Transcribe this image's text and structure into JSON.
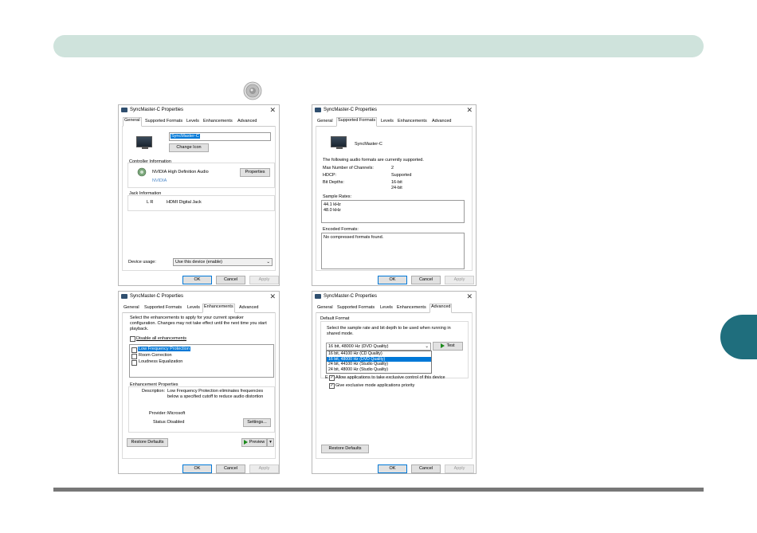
{
  "page": {
    "speaker_icon": "speaker-icon"
  },
  "dialogs": {
    "general": {
      "title": "SyncMaster-C Properties",
      "tabs": [
        "General",
        "Supported Formats",
        "Levels",
        "Enhancements",
        "Advanced"
      ],
      "device_name": "SyncMaster-C",
      "change_icon": "Change Icon",
      "controller_header": "Controller Information",
      "controller_name": "NVIDIA High Definition Audio",
      "controller_vendor": "NVIDIA",
      "properties": "Properties",
      "jack_header": "Jack Information",
      "jack_lr": "L R",
      "jack_name": "HDMI Digital Jack",
      "device_usage_label": "Device usage:",
      "device_usage_value": "Use this device (enable)",
      "ok": "OK",
      "cancel": "Cancel",
      "apply": "Apply"
    },
    "formats": {
      "title": "SyncMaster-C Properties",
      "tabs": [
        "General",
        "Supported Formats",
        "Levels",
        "Enhancements",
        "Advanced"
      ],
      "device_name": "SyncMaster-C",
      "intro": "The following audio formats are currently supported.",
      "max_channels_label": "Max Number of Channels:",
      "max_channels_value": "2",
      "hdcp_label": "HDCP:",
      "hdcp_value": "Supported",
      "bit_depths_label": "Bit Depths:",
      "bit_depths": [
        "16-bit",
        "24-bit"
      ],
      "sample_rates_label": "Sample Rates:",
      "sample_rates": [
        "44.1 kHz",
        "48.0 kHz"
      ],
      "encoded_label": "Encoded Formats:",
      "encoded_value": "No compressed formats found.",
      "ok": "OK",
      "cancel": "Cancel",
      "apply": "Apply"
    },
    "enhancements": {
      "title": "SyncMaster-C Properties",
      "tabs": [
        "General",
        "Supported Formats",
        "Levels",
        "Enhancements",
        "Advanced"
      ],
      "intro_line1": "Select the enhancements to apply for your current speaker",
      "intro_line2": "configuration. Changes may not take effect until the next time you start",
      "intro_line3": "playback.",
      "disable_all": "Disable all enhancements",
      "items": [
        "Low Frequency Protection",
        "Room Correction",
        "Loudness Equalization"
      ],
      "props_header": "Enhancement Properties",
      "desc_label": "Description:",
      "desc_line1": "Low Frequency Protection eliminates frequencies",
      "desc_line2": "below a specified cutoff to reduce audio distortion",
      "provider_label": "Provider:",
      "provider_value": "Microsoft",
      "status_label": "Status:",
      "status_value": "Disabled",
      "settings": "Settings...",
      "restore": "Restore Defaults",
      "preview": "Preview",
      "ok": "OK",
      "cancel": "Cancel",
      "apply": "Apply"
    },
    "advanced": {
      "title": "SyncMaster-C Properties",
      "tabs": [
        "General",
        "Supported Formats",
        "Levels",
        "Enhancements",
        "Advanced"
      ],
      "default_format_header": "Default Format",
      "desc_line1": "Select the sample rate and bit depth to be used when running in",
      "desc_line2": "shared mode.",
      "selected": "16 bit, 48000 Hz (DVD Quality)",
      "test": "Test",
      "options": [
        "16 bit, 44100 Hz (CD Quality)",
        "16 bit, 48000 Hz (DVD Quality)",
        "24 bit, 44100 Hz (Studio Quality)",
        "24 bit, 48000 Hz (Studio Quality)"
      ],
      "exclusive_partial": "E",
      "allow_exclusive": "Allow applications to take exclusive control of this device",
      "give_priority": "Give exclusive mode applications priority",
      "restore": "Restore Defaults",
      "ok": "OK",
      "cancel": "Cancel",
      "apply": "Apply"
    }
  }
}
